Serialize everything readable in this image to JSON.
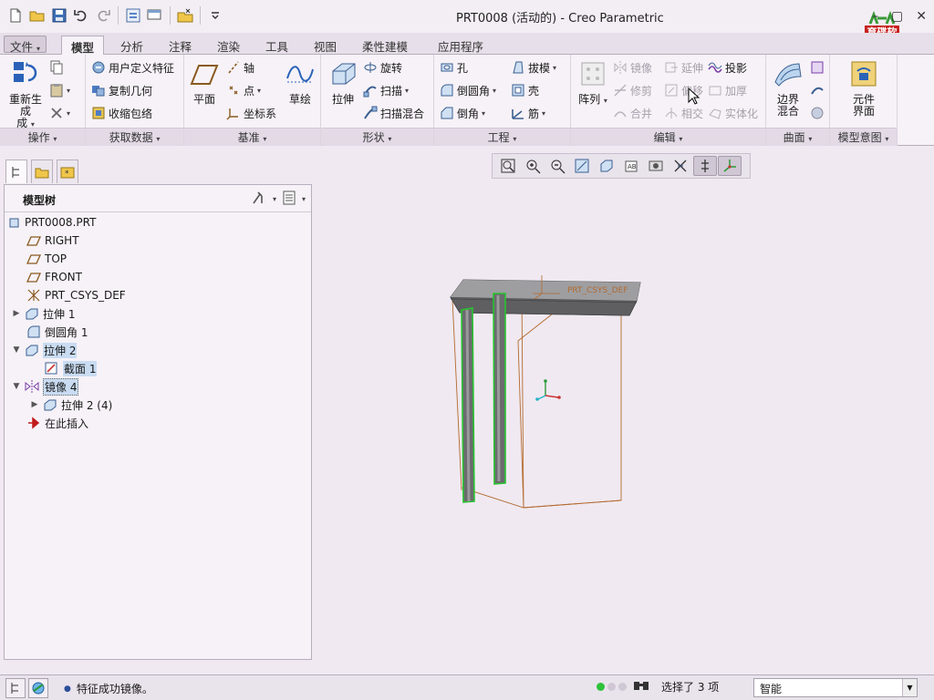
{
  "window": {
    "title": "PRT0008 (活动的) - Creo Parametric"
  },
  "logo": {
    "text": "育碟软件"
  },
  "quick_access": {
    "items": [
      "new-icon",
      "open-icon",
      "save-icon",
      "undo-icon",
      "redo-icon",
      "regenerate-icon",
      "windows-icon",
      "close-icon",
      "customize-icon"
    ]
  },
  "tabs": {
    "file": "文件",
    "items": [
      "模型",
      "分析",
      "注释",
      "渲染",
      "工具",
      "视图",
      "柔性建模",
      "应用程序"
    ],
    "active": "模型"
  },
  "ribbon": {
    "operations": {
      "label": "操作",
      "regenerate": "重新生成",
      "regenerate_sub": "成"
    },
    "get_data": {
      "label": "获取数据",
      "udf": "用户定义特征",
      "copy_geom": "复制几何",
      "shrinkwrap": "收缩包络"
    },
    "datum": {
      "label": "基准",
      "plane": "平面",
      "axis": "轴",
      "point": "点",
      "csys": "坐标系",
      "sketch": "草绘"
    },
    "shapes": {
      "label": "形状",
      "extrude": "拉伸",
      "revolve": "旋转",
      "sweep": "扫描",
      "swept_blend": "扫描混合"
    },
    "engineering": {
      "label": "工程",
      "hole": "孔",
      "round": "倒圆角",
      "chamfer": "倒角",
      "draft": "拔模",
      "shell": "壳",
      "rib": "筋"
    },
    "editing": {
      "label": "编辑",
      "pattern": "阵列",
      "mirror": "镜像",
      "trim": "修剪",
      "merge": "合并",
      "extend": "延伸",
      "offset": "偏移",
      "intersect": "相交",
      "project": "投影",
      "thicken": "加厚",
      "solidify": "实体化"
    },
    "surfaces": {
      "label": "曲面",
      "boundary_blend": "边界混合",
      "boundary_blend_l1": "边界",
      "boundary_blend_l2": "混合"
    },
    "model_intent": {
      "label": "模型意图",
      "component_interface": "元件界面",
      "ci_l1": "元件",
      "ci_l2": "界面"
    }
  },
  "view_toolbar": {
    "items": [
      "refit-icon",
      "zoom-in-icon",
      "zoom-out-icon",
      "repaint-icon",
      "display-style-icon",
      "saved-orientations-icon",
      "view-manager-icon",
      "perspective-icon",
      "datum-display-icon",
      "csys-display-icon",
      "annotation-display-icon"
    ]
  },
  "model_tree": {
    "title": "模型树",
    "nodes": [
      {
        "label": "PRT0008.PRT",
        "icon": "part-icon"
      },
      {
        "label": "RIGHT",
        "icon": "datum-plane-icon"
      },
      {
        "label": "TOP",
        "icon": "datum-plane-icon"
      },
      {
        "label": "FRONT",
        "icon": "datum-plane-icon"
      },
      {
        "label": "PRT_CSYS_DEF",
        "icon": "csys-icon"
      },
      {
        "label": "拉伸 1",
        "icon": "extrude-icon"
      },
      {
        "label": "倒圆角 1",
        "icon": "round-icon"
      },
      {
        "label": "拉伸 2",
        "icon": "extrude-icon"
      },
      {
        "label": "截面 1",
        "icon": "sketch-icon"
      },
      {
        "label": "镜像 4",
        "icon": "mirror-icon"
      },
      {
        "label": "拉伸 2 (4)",
        "icon": "extrude-icon"
      },
      {
        "label": "在此插入",
        "icon": "insert-here-icon"
      }
    ]
  },
  "graphics": {
    "csys_label": "PRT_CSYS_DEF"
  },
  "status": {
    "message": "特征成功镜像。",
    "selection": "选择了 3 项",
    "filter": "智能"
  }
}
